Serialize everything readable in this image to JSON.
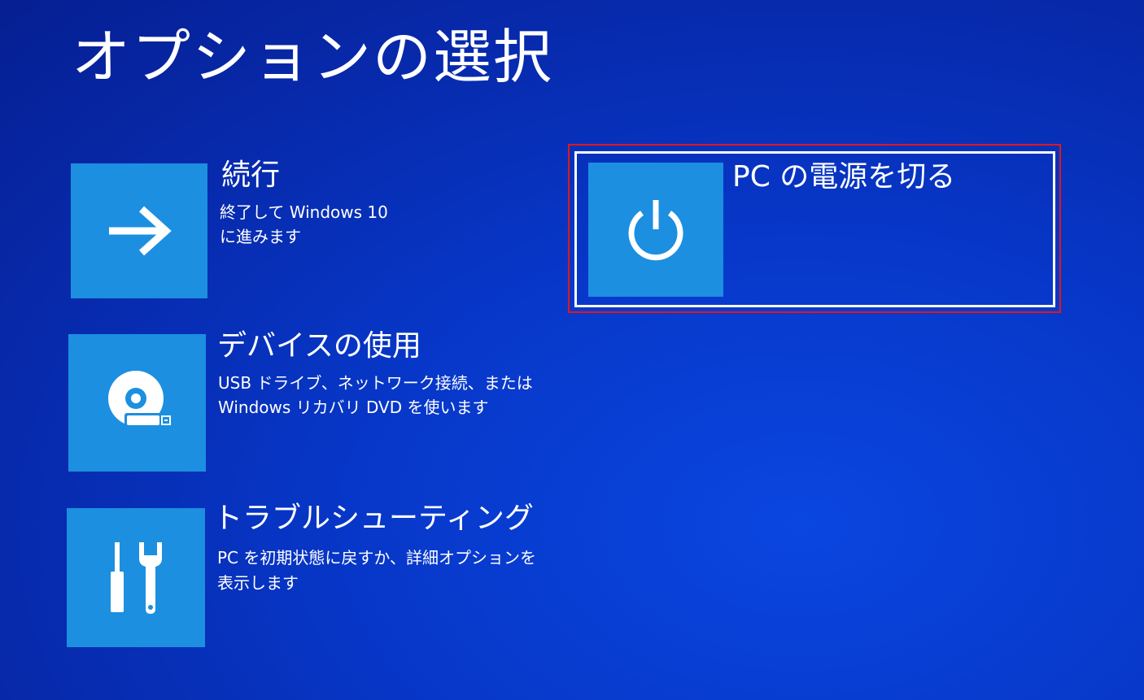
{
  "page": {
    "title": "オプションの選択"
  },
  "options": [
    {
      "title": "続行",
      "desc_line1": "終了して Windows 10",
      "desc_line2": "に進みます",
      "icon": "arrow-right-icon"
    },
    {
      "title": "デバイスの使用",
      "desc_line1": "USB ドライブ、ネットワーク接続、または",
      "desc_line2": "Windows リカバリ DVD を使います",
      "icon": "disc-usb-icon"
    },
    {
      "title": "トラブルシューティング",
      "desc_line1": "PC を初期状態に戻すか、詳細オプションを",
      "desc_line2": "表示します",
      "icon": "tools-icon"
    },
    {
      "title": "PC の電源を切る",
      "icon": "power-icon"
    }
  ],
  "colors": {
    "background": "#0737c8",
    "tile": "#1c8fe0",
    "highlight": "#e01818"
  }
}
